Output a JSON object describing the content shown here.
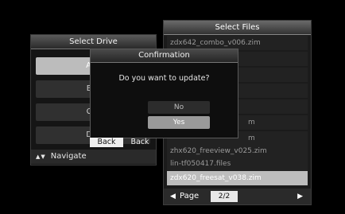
{
  "drive_panel": {
    "title": "Select Drive",
    "items": [
      "A:D",
      "B:E",
      "C:E",
      "D:E"
    ],
    "selected_index": 0,
    "nav_label": "Navigate"
  },
  "files_panel": {
    "title": "Select Files",
    "items": [
      "zdx642_combo_v006.zim",
      "",
      "",
      "",
      "",
      "m",
      "m",
      "zhx620_freeview_v025.zim",
      "lin-tf050417.files",
      "zdx620_freesat_v038.zim"
    ],
    "selected_index": 9,
    "page_label": "Page",
    "page_value": "2/2"
  },
  "dialog": {
    "title": "Confirmation",
    "message": "Do you want to update?",
    "no_label": "No",
    "yes_label": "Yes",
    "selected": "Yes"
  },
  "back_buttons": [
    "Back",
    "Back"
  ]
}
